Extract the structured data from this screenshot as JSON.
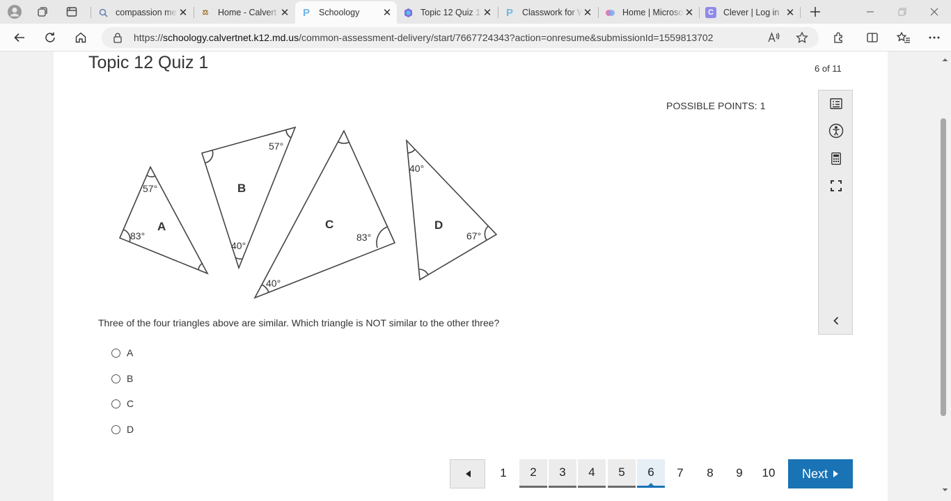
{
  "browser": {
    "tabs": [
      {
        "title": "compassion me",
        "icon": "search-icon",
        "active": false
      },
      {
        "title": "Home - Calvert",
        "icon": "district-logo",
        "active": false
      },
      {
        "title": "Schoology",
        "icon": "schoology-icon",
        "active": true
      },
      {
        "title": "Topic 12 Quiz 1",
        "icon": "copilot-icon",
        "active": false
      },
      {
        "title": "Classwork for W",
        "icon": "schoology-icon",
        "active": false
      },
      {
        "title": "Home | Microso",
        "icon": "copilot-icon",
        "active": false
      },
      {
        "title": "Clever | Log in",
        "icon": "clever-icon",
        "active": false
      }
    ],
    "url_prefix": "https://",
    "url_host": "schoology.calvertnet.k12.md.us",
    "url_path": "/common-assessment-delivery/start/7667724343?action=onresume&submissionId=1559813702"
  },
  "quiz": {
    "title": "Topic 12 Quiz 1",
    "progress": "6 of 11",
    "possible_points": "POSSIBLE POINTS: 1",
    "question": "Three of the four triangles above are similar.  Which triangle is NOT similar to the other three?",
    "choices": [
      "A",
      "B",
      "C",
      "D"
    ],
    "figure": {
      "labels": [
        "A",
        "B",
        "C",
        "D"
      ],
      "angles": {
        "A": [
          "57°",
          "83°"
        ],
        "B": [
          "57°",
          "40°"
        ],
        "C": [
          "83°",
          "40°"
        ],
        "D": [
          "40°",
          "67°"
        ]
      }
    }
  },
  "pager": {
    "pages": [
      "1",
      "2",
      "3",
      "4",
      "5",
      "6",
      "7",
      "8",
      "9",
      "10"
    ],
    "current": "6",
    "next_label": "Next"
  },
  "colors": {
    "accent": "#1a73b4",
    "rail": "#ececec"
  }
}
